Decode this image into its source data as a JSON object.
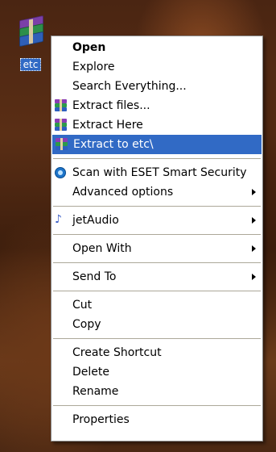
{
  "desktop": {
    "icon_label": "etc",
    "icon_name": "winrar-archive-icon"
  },
  "menu": {
    "items": [
      {
        "label": "Open",
        "bold": true
      },
      {
        "label": "Explore"
      },
      {
        "label": "Search Everything..."
      },
      {
        "label": "Extract files...",
        "icon": "winrar-icon"
      },
      {
        "label": "Extract Here",
        "icon": "winrar-icon"
      },
      {
        "label": "Extract to etc\\",
        "icon": "winrar-icon",
        "highlighted": true
      },
      {
        "label": "Scan with ESET Smart Security",
        "icon": "eset-icon"
      },
      {
        "label": "Advanced options",
        "submenu": true
      },
      {
        "label": "jetAudio",
        "icon": "jetaudio-icon",
        "submenu": true
      },
      {
        "label": "Open With",
        "submenu": true
      },
      {
        "label": "Send To",
        "submenu": true
      },
      {
        "label": "Cut"
      },
      {
        "label": "Copy"
      },
      {
        "label": "Create Shortcut"
      },
      {
        "label": "Delete"
      },
      {
        "label": "Rename"
      },
      {
        "label": "Properties"
      }
    ]
  },
  "colors": {
    "highlight": "#316ac5",
    "separator": "#aca899"
  }
}
